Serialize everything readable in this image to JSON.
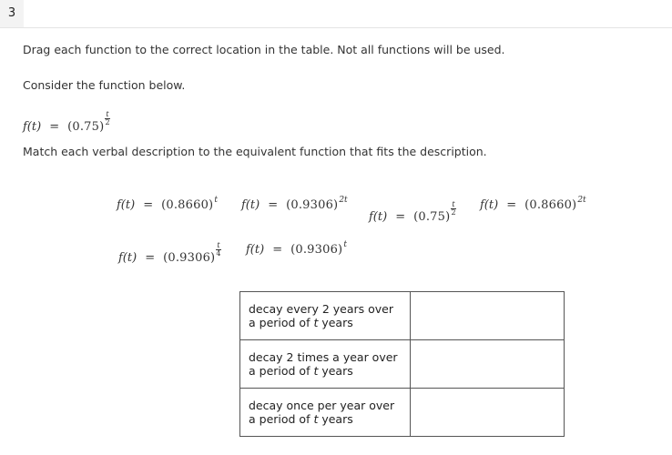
{
  "question_number": "3",
  "instructions": "Drag each function to the correct location in the table. Not all functions will be used.",
  "prompt": "Consider the function below.",
  "given_function": {
    "lhs": "f(t)",
    "eq": "=",
    "base": "(0.75)",
    "exp_num": "t",
    "exp_den": "2"
  },
  "match_instruction": "Match each verbal description to the equivalent function that fits the description.",
  "choices": [
    {
      "lhs": "f(t)",
      "eq": "=",
      "base": "(0.8660)",
      "exp": "t"
    },
    {
      "lhs": "f(t)",
      "eq": "=",
      "base": "(0.9306)",
      "exp": "2t"
    },
    {
      "lhs": "f(t)",
      "eq": "=",
      "base": "(0.75)",
      "exp_num": "t",
      "exp_den": "2"
    },
    {
      "lhs": "f(t)",
      "eq": "=",
      "base": "(0.8660)",
      "exp": "2t"
    },
    {
      "lhs": "f(t)",
      "eq": "=",
      "base": "(0.9306)",
      "exp_num": "t",
      "exp_den": "4"
    },
    {
      "lhs": "f(t)",
      "eq": "=",
      "base": "(0.9306)",
      "exp": "t"
    }
  ],
  "table": {
    "rows": [
      {
        "desc_pre": "decay every 2 years over a period of ",
        "var": "t",
        "desc_post": " years",
        "drop_value": ""
      },
      {
        "desc_pre": "decay 2 times a year over a period of ",
        "var": "t",
        "desc_post": " years",
        "drop_value": ""
      },
      {
        "desc_pre": "decay once per year over a period of ",
        "var": "t",
        "desc_post": " years",
        "drop_value": ""
      }
    ]
  }
}
